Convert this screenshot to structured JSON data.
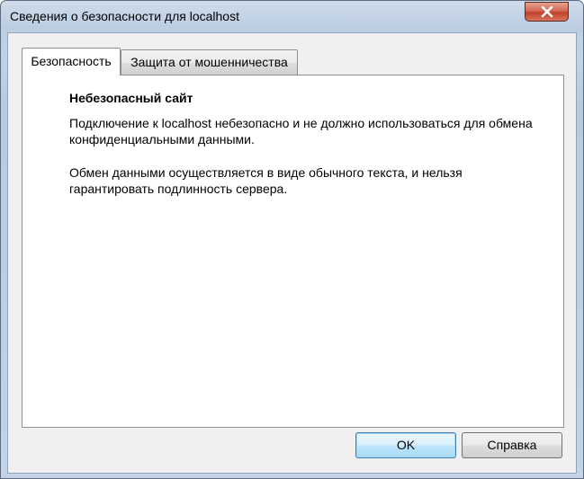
{
  "window": {
    "title": "Сведения о безопасности для localhost"
  },
  "tabs": [
    {
      "label": "Безопасность",
      "active": true
    },
    {
      "label": "Защита от мошенничества",
      "active": false
    }
  ],
  "security": {
    "heading": "Небезопасный сайт",
    "paragraph1": "Подключение к localhost небезопасно и не должно использоваться для обмена конфиденциальными данными.",
    "paragraph2": "Обмен данными осуществляется в виде обычного текста, и нельзя гарантировать подлинность сервера."
  },
  "buttons": {
    "ok_label": "OK",
    "help_label": "Справка"
  },
  "colors": {
    "close_button": "#c7432c",
    "default_button_border": "#3c7fb1"
  },
  "icons": {
    "close": "close-icon"
  }
}
